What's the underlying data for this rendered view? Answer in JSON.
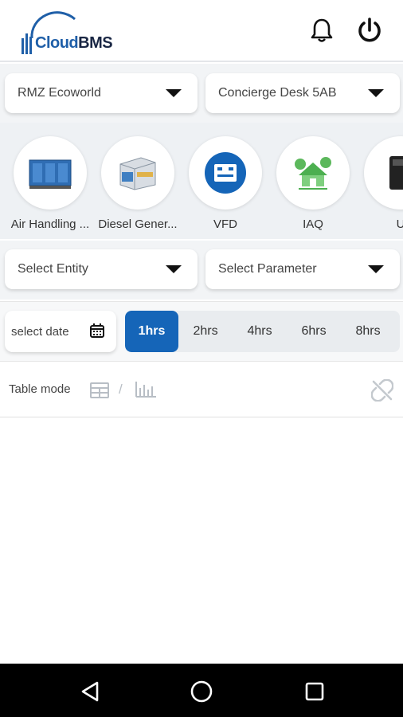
{
  "header": {
    "logo_text_cloud": "Cloud",
    "logo_text_bms": "BMS",
    "bell_icon": "bell-icon",
    "power_icon": "power-icon"
  },
  "filters": {
    "site": "RMZ Ecoworld",
    "location": "Concierge Desk 5AB",
    "entity_placeholder": "Select Entity",
    "parameter_placeholder": "Select Parameter"
  },
  "categories": [
    {
      "label": "Air Handling ...",
      "icon": "ahu-unit-icon"
    },
    {
      "label": "Diesel Gener...",
      "icon": "diesel-generator-icon"
    },
    {
      "label": "VFD",
      "icon": "vfd-icon"
    },
    {
      "label": "IAQ",
      "icon": "iaq-house-icon"
    },
    {
      "label": "U",
      "icon": "ups-icon"
    }
  ],
  "time": {
    "date_placeholder": "select date",
    "ranges": [
      "1hrs",
      "2hrs",
      "4hrs",
      "6hrs",
      "8hrs"
    ],
    "selected": "1hrs"
  },
  "mode": {
    "label": "Table mode",
    "separator": "/"
  },
  "colors": {
    "accent": "#1565b8",
    "strip_bg": "#eef1f4"
  }
}
